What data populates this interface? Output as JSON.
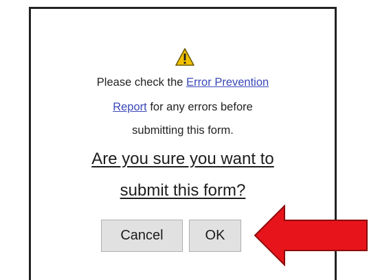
{
  "dialog": {
    "icon": "warning-triangle-icon",
    "message": {
      "prefix": "Please check the",
      "link_part1": "Error Prevention",
      "link_part2": "Report",
      "suffix": "for any errors before",
      "line3": "submitting this form."
    },
    "question": {
      "line1": "Are you sure you want to",
      "line2": "submit this form?"
    },
    "buttons": {
      "cancel_label": "Cancel",
      "ok_label": "OK"
    }
  },
  "annotation": {
    "arrow_icon": "red-arrow-left-icon",
    "arrow_color": "#e8141b",
    "arrow_outline": "#8a0b0b"
  },
  "colors": {
    "link": "#3a48b8",
    "warning_fill": "#f2c200",
    "button_bg": "#e1e1e1"
  }
}
